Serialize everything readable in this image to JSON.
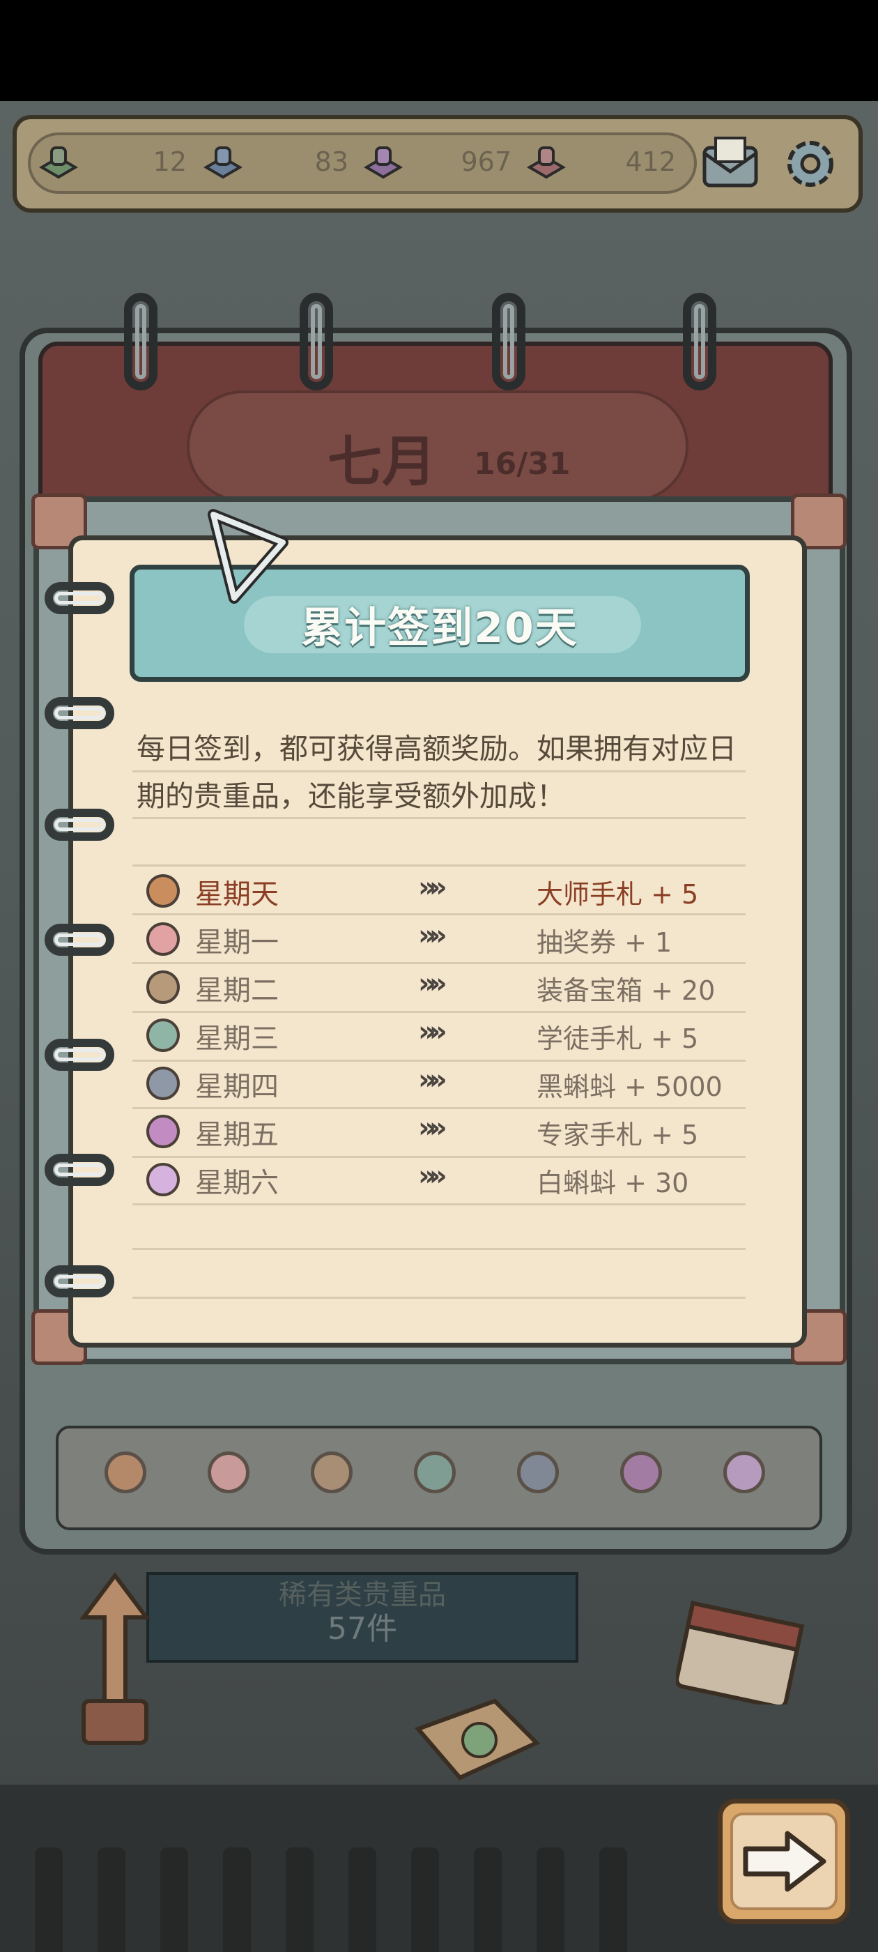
{
  "resources": [
    {
      "icon": "green-pawn-icon",
      "value": "12"
    },
    {
      "icon": "blue-pawn-icon",
      "value": "83"
    },
    {
      "icon": "purple-pawn-icon",
      "value": "967"
    },
    {
      "icon": "red-pawn-icon",
      "value": "412"
    }
  ],
  "header": {
    "mail_icon": "mail-icon",
    "settings_icon": "gear-icon"
  },
  "calendar": {
    "month": "七月",
    "progress": "16/31"
  },
  "card": {
    "title": "累计签到20天",
    "description": "每日签到，都可获得高额奖励。如果拥有对应日期的贵重品，还能享受额外加成！",
    "rows": [
      {
        "day": "星期天",
        "reward": "大师手札 + 5",
        "color": "#c98d5e",
        "highlight": true
      },
      {
        "day": "星期一",
        "reward": "抽奖券 + 1",
        "color": "#e2a1a3",
        "highlight": false
      },
      {
        "day": "星期二",
        "reward": "装备宝箱 + 20",
        "color": "#b79a7a",
        "highlight": false
      },
      {
        "day": "星期三",
        "reward": "学徒手札 + 5",
        "color": "#8fb5a6",
        "highlight": false
      },
      {
        "day": "星期四",
        "reward": "黑蝌蚪 + 5000",
        "color": "#8e98a6",
        "highlight": false
      },
      {
        "day": "星期五",
        "reward": "专家手札 + 5",
        "color": "#c28cc2",
        "highlight": false
      },
      {
        "day": "星期六",
        "reward": "白蝌蚪 + 30",
        "color": "#d6b2df",
        "highlight": false
      }
    ]
  },
  "lower": {
    "title": "稀有类贵重品",
    "count": "57件"
  },
  "next_button_icon": "arrow-right-icon"
}
